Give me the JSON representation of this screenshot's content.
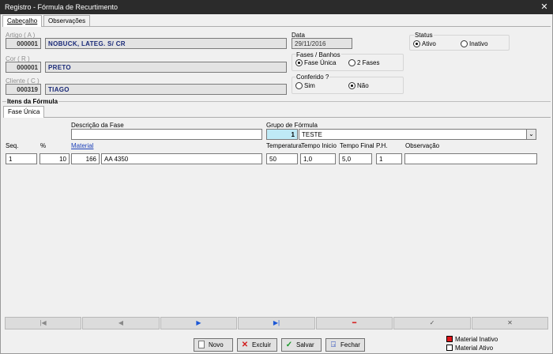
{
  "window": {
    "title": "Registro - Fórmula de Recurtimento",
    "close_icon": "close-icon"
  },
  "tabs": [
    {
      "label": "Cabeçalho"
    },
    {
      "label": "Observações"
    }
  ],
  "header": {
    "artigo": {
      "label": "Artigo ( A )",
      "code": "000001",
      "name": "NOBUCK, LATEG. S/ CR"
    },
    "cor": {
      "label": "Cor ( R )",
      "code": "000001",
      "name": "PRETO"
    },
    "cliente": {
      "label": "Cliente ( C )",
      "code": "000319",
      "name": "TIAGO"
    },
    "data": {
      "label": "Data",
      "value": "29/11/2016"
    },
    "fases": {
      "label": "Fases / Banhos",
      "options": [
        "Fase Única",
        "2 Fases"
      ],
      "selected": "Fase Única"
    },
    "conferido": {
      "label": "Conferido ?",
      "options": [
        "Sim",
        "Não"
      ],
      "selected": "Não"
    },
    "status": {
      "label": "Status",
      "options": [
        "Ativo",
        "Inativo"
      ],
      "selected": "Ativo"
    }
  },
  "itens": {
    "section_title": "Itens da Fórmula",
    "subtab": "Fase Única",
    "descricao_label": "Descrição da Fase",
    "descricao_value": "",
    "grupo_label": "Grupo de Fórmula",
    "grupo_code": "1",
    "grupo_name": "TESTE",
    "columns": {
      "seq": "Seq.",
      "pct": "%",
      "material": "Material",
      "temperatura": "Temperatura",
      "tempo_inicio": "Tempo Inicio",
      "tempo_final": "Tempo Final",
      "ph": "P.H.",
      "observacao": "Observação"
    },
    "row": {
      "seq": "1",
      "pct": "10",
      "material_code": "166",
      "material_name": "AA 4350",
      "temperatura": "50",
      "tempo_inicio": "1,0",
      "tempo_final": "5,0",
      "ph": "1",
      "observacao": ""
    }
  },
  "navigation": {
    "buttons": [
      {
        "name": "first-record-button",
        "glyph": "|◀"
      },
      {
        "name": "prev-record-button",
        "glyph": "◀"
      },
      {
        "name": "next-record-button",
        "glyph": "▶"
      },
      {
        "name": "last-record-button",
        "glyph": "▶|"
      },
      {
        "name": "delete-record-button",
        "glyph": "━"
      },
      {
        "name": "confirm-button",
        "glyph": "✓"
      },
      {
        "name": "cancel-button",
        "glyph": "✕"
      }
    ]
  },
  "actions": {
    "novo": "Novo",
    "excluir": "Excluir",
    "salvar": "Salvar",
    "fechar": "Fechar"
  },
  "legend": {
    "inativo": {
      "label": "Material Inativo",
      "color": "#e0161b"
    },
    "ativo": {
      "label": "Material Ativo",
      "color": "#ffffff"
    }
  }
}
